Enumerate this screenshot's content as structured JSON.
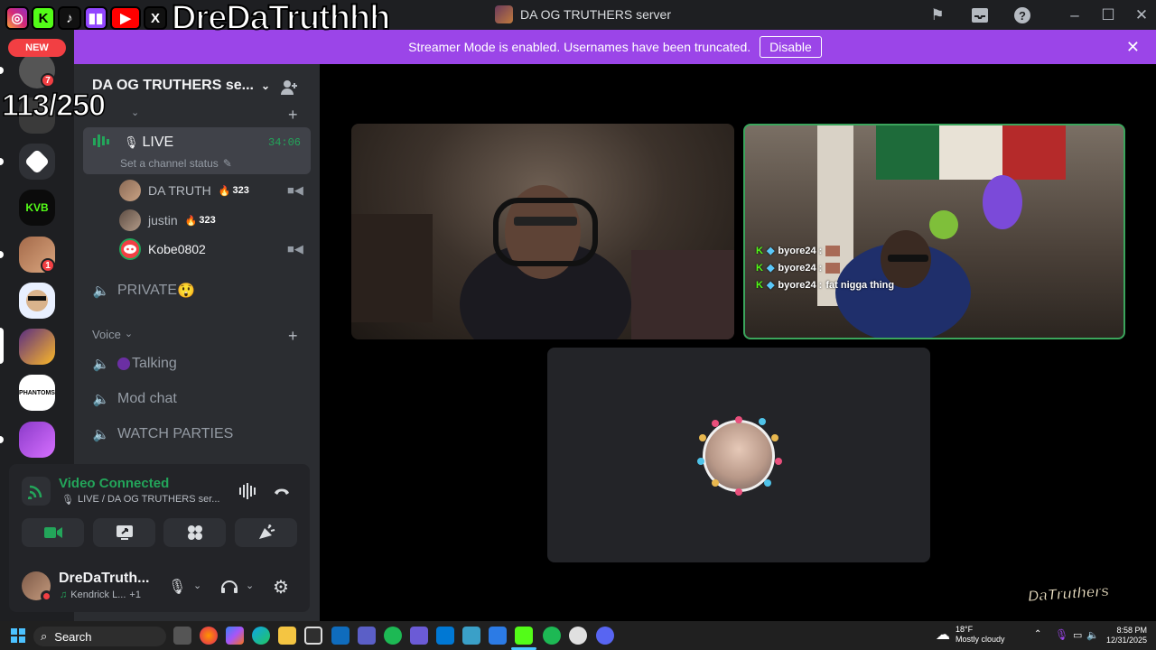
{
  "overlay": {
    "handle": "DreDaTruthhh",
    "new_badge": "NEW",
    "viewer_counter": "113/250",
    "watermark": "DaTruthers"
  },
  "window": {
    "title": "DA OG TRUTHERS server"
  },
  "banner": {
    "message": "Streamer Mode is enabled. Usernames have been truncated.",
    "button": "Disable"
  },
  "rail": {
    "badges": [
      "7",
      "1"
    ]
  },
  "guild": {
    "name": "DA OG TRUTHERS se...",
    "live_channel": {
      "name": "LIVE",
      "timer": "34:06",
      "status_placeholder": "Set a channel status"
    },
    "members": [
      {
        "name": "DA TRUTH",
        "streak": "323"
      },
      {
        "name": "justin",
        "streak": "323"
      },
      {
        "name": "Kobe0802",
        "streak": ""
      }
    ],
    "private_channel": "PRIVATE",
    "private_emoji": "😲",
    "voice_category": "Voice",
    "voice_channels": [
      "Talking",
      "Mod chat",
      "WATCH PARTIES"
    ]
  },
  "voice_panel": {
    "status": "Video Connected",
    "location": "LIVE / DA OG TRUTHERS ser...",
    "user_name": "DreDaTruth...",
    "activity": "Kendrick L...",
    "activity_extra": "+1"
  },
  "chat_overlay": [
    {
      "user": "byore24 :",
      "text": ""
    },
    {
      "user": "byore24 :",
      "text": ""
    },
    {
      "user": "byore24 :",
      "text": "fat nigga thing"
    }
  ],
  "taskbar": {
    "search": "Search",
    "weather_temp": "18°F",
    "weather_desc": "Mostly cloudy",
    "time": "8:58 PM",
    "date": "12/31/2025"
  },
  "colors": {
    "banner": "#9b45e8",
    "connected": "#23a55a",
    "speaking_ring": "#3ba55c",
    "badge": "#f23f43"
  }
}
